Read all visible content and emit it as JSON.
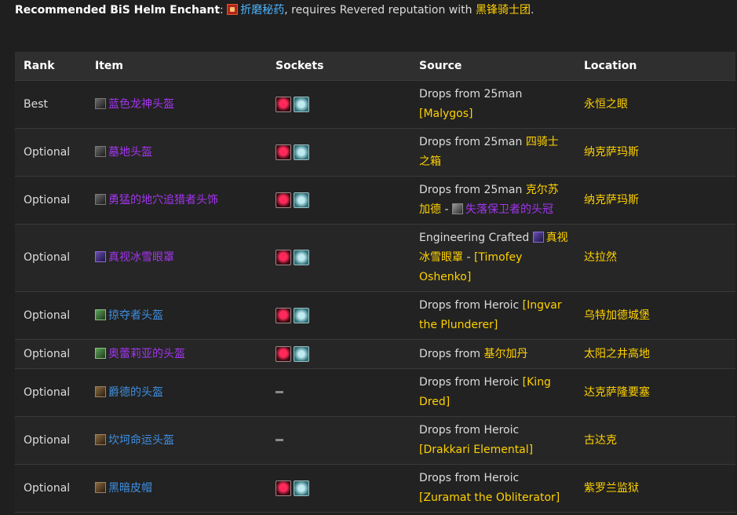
{
  "intro": {
    "label": "Recommended BiS Helm Enchant",
    "colon": ":",
    "enchant": "折磨秘药",
    "middle": ", requires Revered reputation with ",
    "faction": "黑锋骑士团",
    "end": "."
  },
  "table": {
    "headers": {
      "rank": "Rank",
      "item": "Item",
      "sockets": "Sockets",
      "source": "Source",
      "location": "Location"
    },
    "rows": [
      {
        "rank": "Best",
        "item": "蓝色龙神头盔",
        "source_text": "Drops from 25man",
        "source_link": "[Malygos]",
        "location": "永恒之眼"
      },
      {
        "rank": "Optional",
        "item": "墓地头盔",
        "source_text": "Drops from 25man",
        "source_link": "四骑士之箱",
        "location": "纳克萨玛斯"
      },
      {
        "rank": "Optional",
        "item": "勇猛的地穴追猎者头饰",
        "source_text": "Drops from 25man",
        "source_link": "克尔苏加德",
        "source_sep": " - ",
        "source_link2": "失落保卫者的头冠",
        "location": "纳克萨玛斯"
      },
      {
        "rank": "Optional",
        "item": "真视冰雪眼罩",
        "source_text": "Engineering Crafted",
        "source_link": "真视冰雪眼罩",
        "source_sep": " - ",
        "source_link2": "[Timofey Oshenko]",
        "location": "达拉然"
      },
      {
        "rank": "Optional",
        "item": "掠夺者头盔",
        "source_text": "Drops from Heroic",
        "source_link": "[Ingvar the Plunderer]",
        "location": "乌特加德城堡"
      },
      {
        "rank": "Optional",
        "item": "奥蕾莉亚的头盔",
        "source_text": "Drops from",
        "source_link": "基尔加丹",
        "location": "太阳之井高地"
      },
      {
        "rank": "Optional",
        "item": "爵德的头盔",
        "source_text": "Drops from Heroic",
        "source_link": "[King Dred]",
        "location": "达克萨隆要塞"
      },
      {
        "rank": "Optional",
        "item": "坎坷命运头盔",
        "source_text": "Drops from Heroic",
        "source_link": "[Drakkari Elemental]",
        "location": "古达克"
      },
      {
        "rank": "Optional",
        "item": "黑暗皮帽",
        "source_text": "Drops from Heroic",
        "source_link": "[Zuramat the Obliterator]",
        "location": "紫罗兰监狱"
      }
    ]
  },
  "colors": {
    "epic": "#a335ee",
    "rare": "#3f8ee0",
    "gold": "#ffd100",
    "link_blue": "#4db6ff"
  }
}
